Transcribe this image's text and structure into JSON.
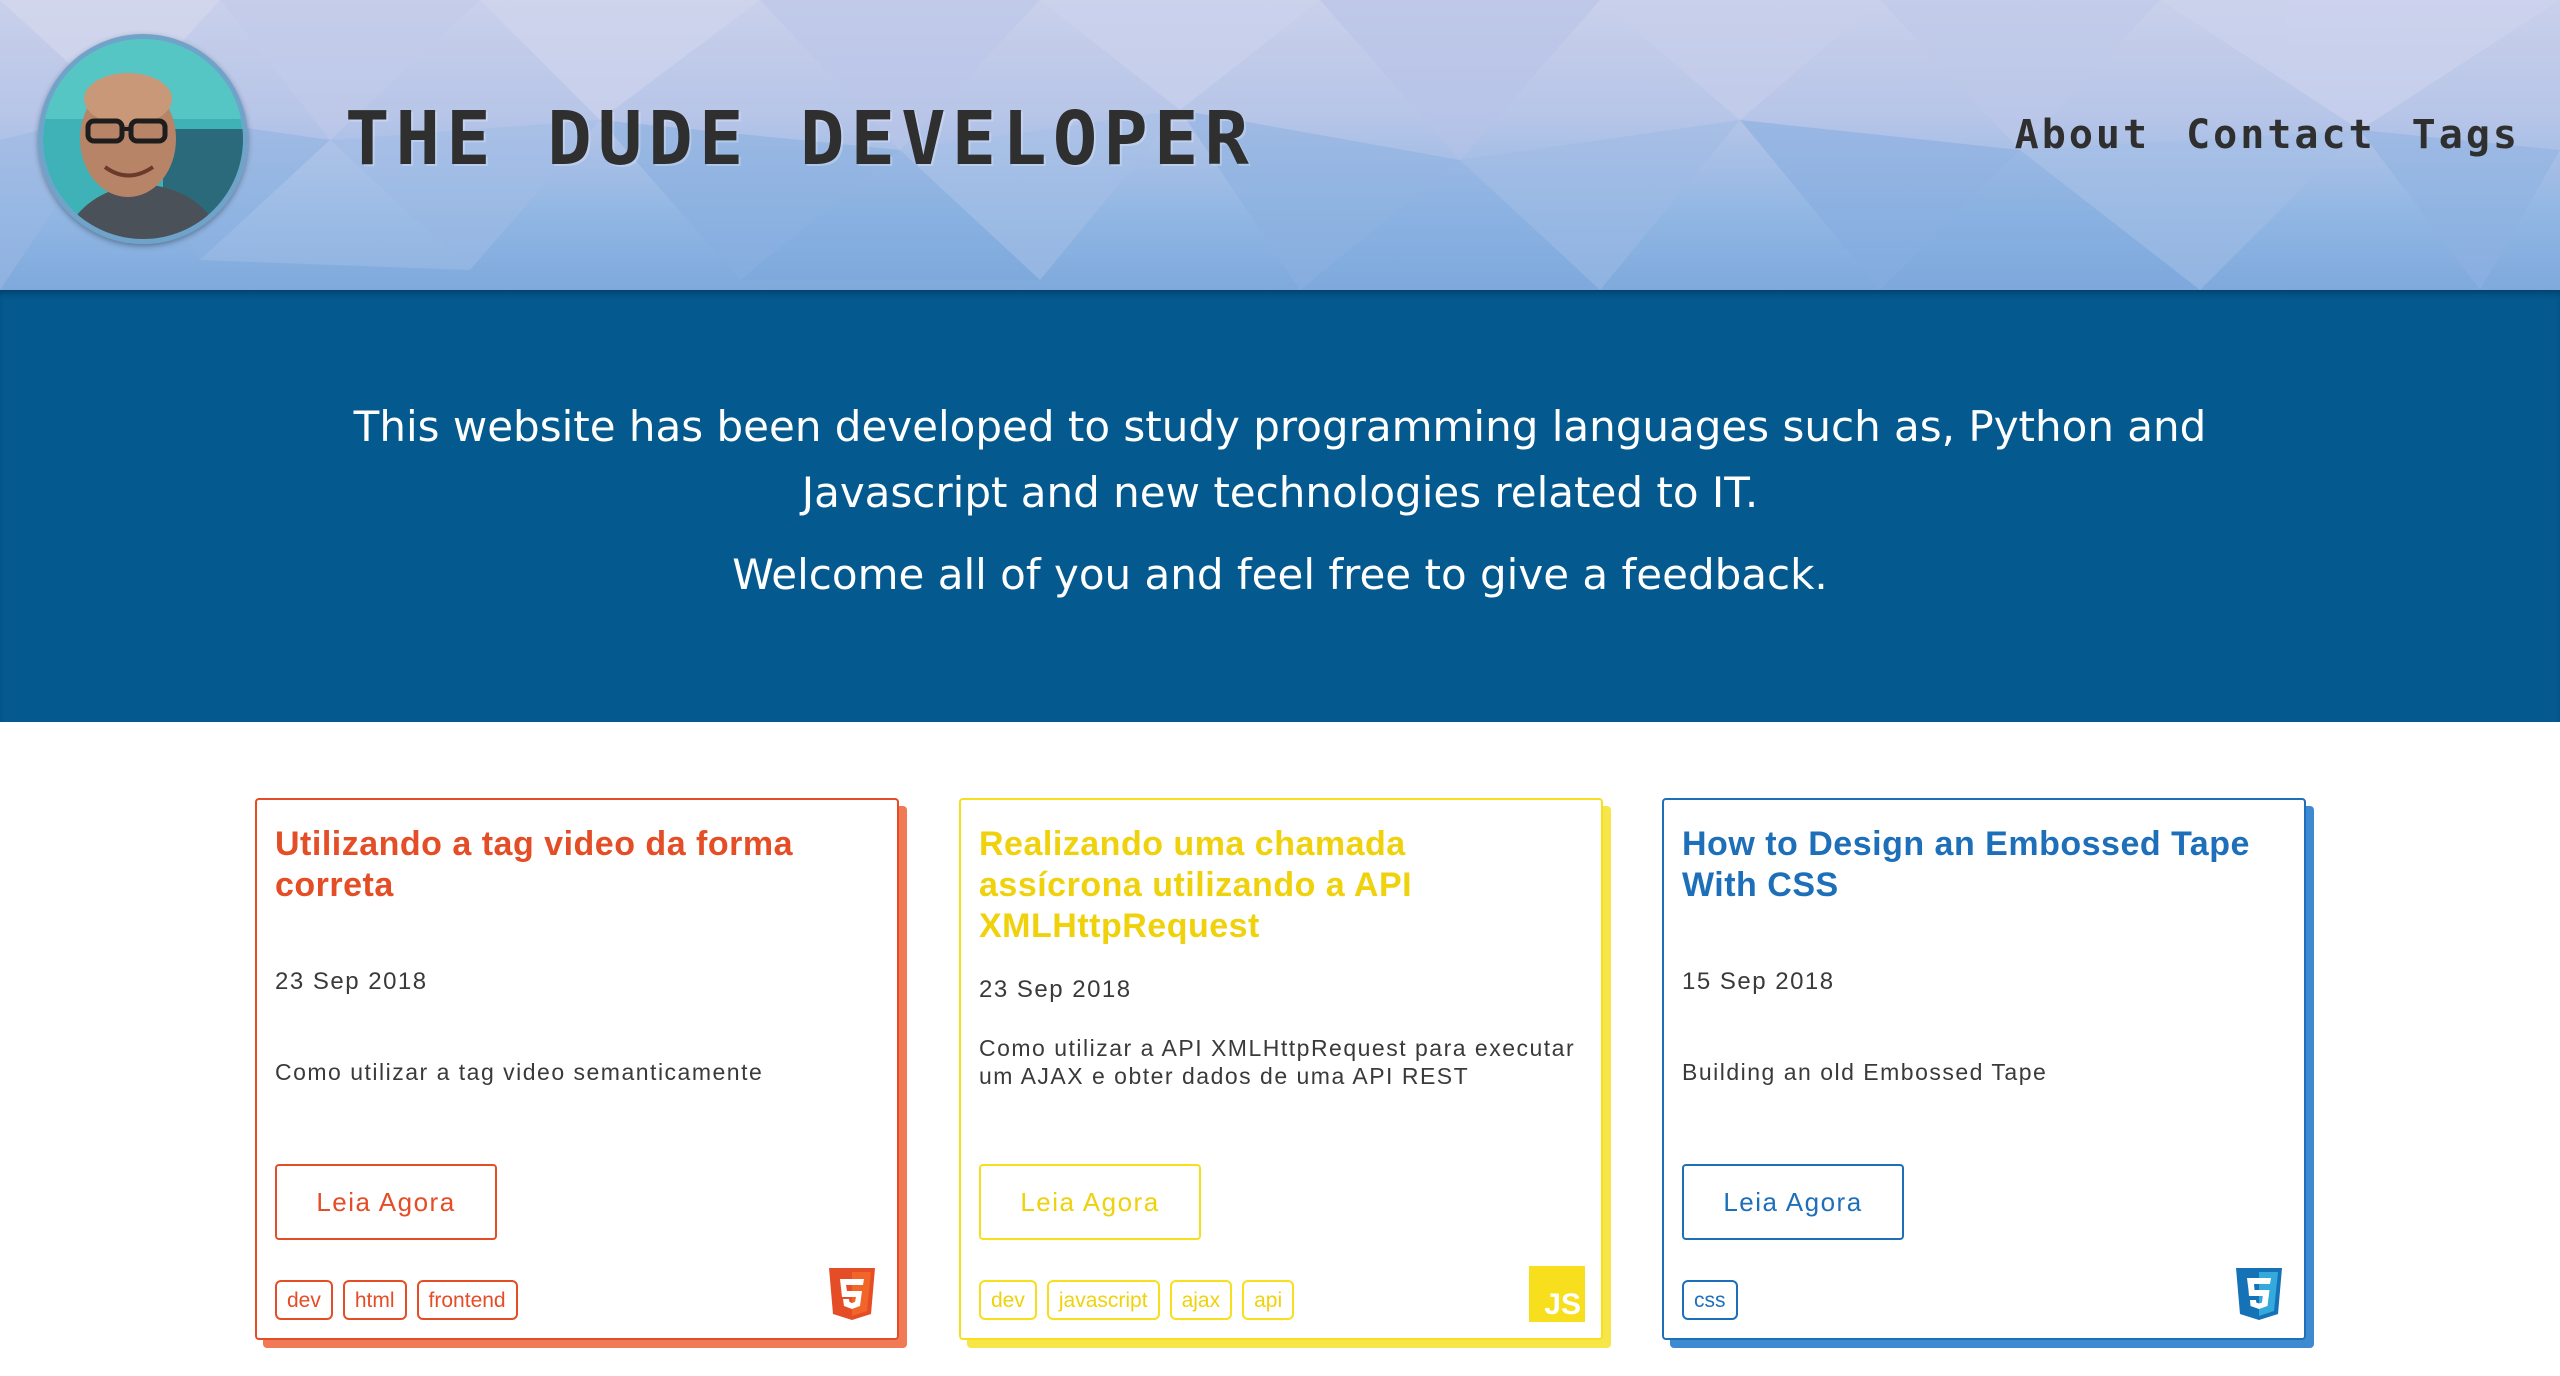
{
  "header": {
    "site_title": "THE DUDE DEVELOPER",
    "nav": [
      {
        "label": "About"
      },
      {
        "label": "Contact"
      },
      {
        "label": "Tags"
      }
    ]
  },
  "intro": {
    "line1": "This website has been developed to study programming languages such as, Python and Javascript and new technologies related to IT.",
    "line2": "Welcome all of you and feel free to give a feedback."
  },
  "colors": {
    "banner": "#04598f",
    "html_card": "#e44d26",
    "js_card": "#f7df1e",
    "css_card": "#1e6fba"
  },
  "posts": [
    {
      "title": "Utilizando a tag video da forma correta",
      "date": "23 Sep 2018",
      "description": "Como utilizar a tag video semanticamente",
      "button": "Leia Agora",
      "tags": [
        "dev",
        "html",
        "frontend"
      ],
      "icon": "html5-icon"
    },
    {
      "title": "Realizando uma chamada assícrona utilizando a API XMLHttpRequest",
      "date": "23 Sep 2018",
      "description": "Como utilizar a API XMLHttpRequest para executar um AJAX e obter dados de uma API REST",
      "button": "Leia Agora",
      "tags": [
        "dev",
        "javascript",
        "ajax",
        "api"
      ],
      "icon": "javascript-icon",
      "icon_text": "JS"
    },
    {
      "title": "How to Design an Embossed Tape With CSS",
      "date": "15 Sep 2018",
      "description": "Building an old Embossed Tape",
      "button": "Leia Agora",
      "tags": [
        "css"
      ],
      "icon": "css3-icon"
    }
  ]
}
